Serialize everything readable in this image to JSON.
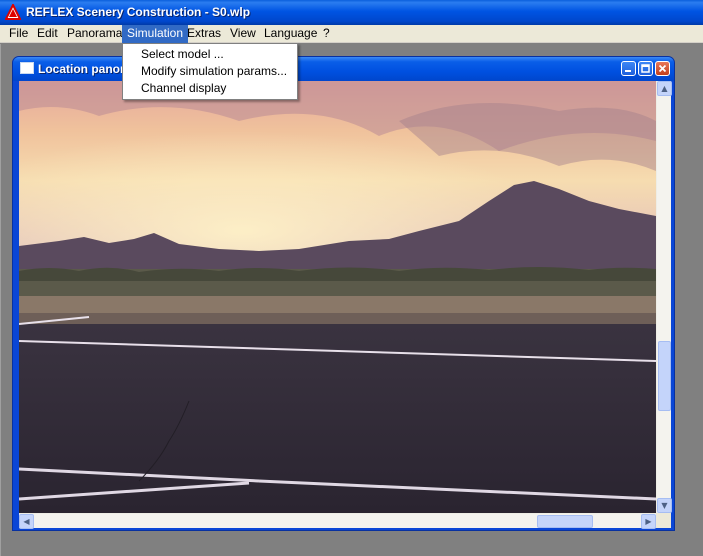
{
  "app": {
    "title": "REFLEX Scenery  Construction - S0.wlp",
    "icon": "reflex-triangle-icon"
  },
  "menubar": {
    "items": [
      "File",
      "Edit",
      "Panorama",
      "Simulation",
      "Extras",
      "View",
      "Language",
      "?"
    ],
    "active": "Simulation"
  },
  "dropdown": {
    "items": [
      "Select model ...",
      "Modify simulation params...",
      "Channel display"
    ]
  },
  "child_window": {
    "title": "Location panor",
    "buttons": [
      "minimize-icon",
      "maximize-icon",
      "close-icon"
    ]
  },
  "colors": {
    "titlebar": "#0054e3",
    "menu_highlight": "#316ac5",
    "desktop": "#808080"
  }
}
